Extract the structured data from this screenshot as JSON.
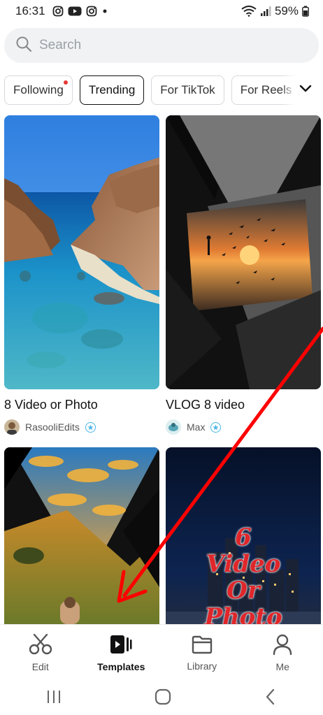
{
  "status": {
    "time": "16:31",
    "battery": "59%"
  },
  "search": {
    "placeholder": "Search"
  },
  "tabs": [
    {
      "label": "Following"
    },
    {
      "label": "Trending"
    },
    {
      "label": "For TikTok"
    },
    {
      "label": "For Reels"
    }
  ],
  "cards": [
    {
      "title": "8 Video or Photo",
      "author": "RasooliEdits"
    },
    {
      "title": "VLOG 8 video",
      "author": "Max"
    },
    {
      "title": "",
      "author": ""
    },
    {
      "title": "",
      "author": ""
    }
  ],
  "card4_overlay": {
    "line1": "6",
    "line2": "Video",
    "line3": "Or",
    "line4": "Photo"
  },
  "bottom_nav": [
    {
      "label": "Edit",
      "icon": "scissors-icon"
    },
    {
      "label": "Templates",
      "icon": "templates-icon",
      "active": true
    },
    {
      "label": "Library",
      "icon": "folder-icon"
    },
    {
      "label": "Me",
      "icon": "person-icon"
    }
  ],
  "colors": {
    "accent_red": "#e53935",
    "verified_blue": "#49b6e8",
    "annotation_arrow": "#ff0000"
  }
}
